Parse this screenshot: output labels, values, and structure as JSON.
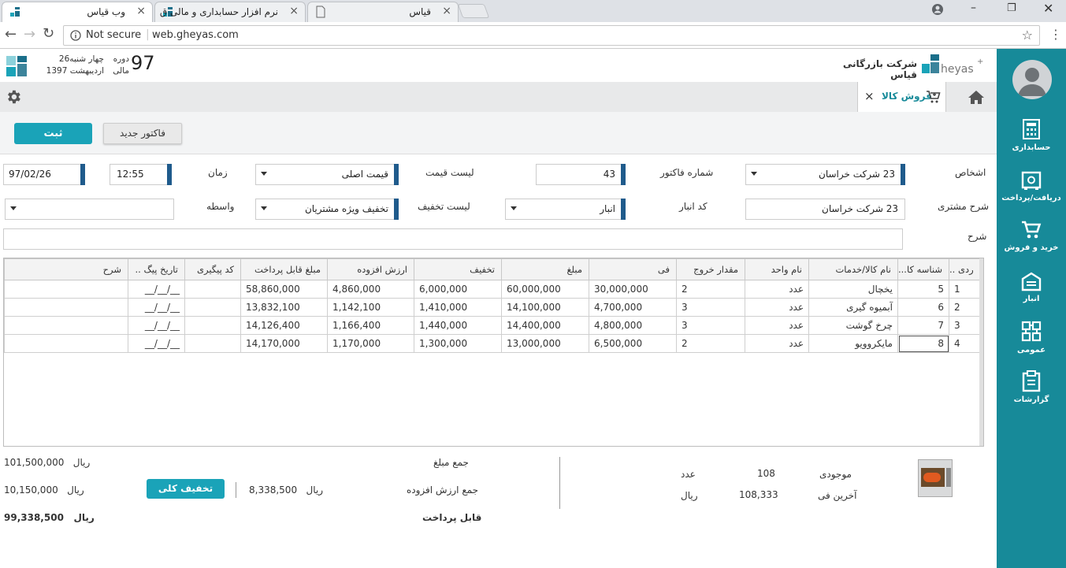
{
  "browser": {
    "tabs": [
      {
        "title": "وب قیاس"
      },
      {
        "title": "نرم افزار حسابداری و مالی ق"
      },
      {
        "title": "قیاس"
      }
    ],
    "security": "Not secure",
    "url": "web.gheyas.com"
  },
  "header": {
    "company_name": "شرکت بازرگانی قیاس",
    "period_number": "97",
    "period_label": "دوره",
    "period_label2": "مالی",
    "weekday": "چهار شنبه26",
    "date_text": "اردیبهشت 1397"
  },
  "tabs": [
    {
      "label": "فروش کالا"
    }
  ],
  "actions": {
    "submit": "ثبت",
    "new_invoice": "فاکتور جدید"
  },
  "form": {
    "persons_label": "اشخاص",
    "persons_value": "23 شرکت خراسان",
    "invoice_no_label": "شماره فاکتور",
    "invoice_no_value": "43",
    "price_list_label": "لیست قیمت",
    "price_list_value": "قیمت اصلی",
    "time_label": "زمان",
    "time_value": "12:55",
    "date_value": "97/02/26",
    "customer_desc_label": "شرح مشتری",
    "customer_desc_value": "23 شرکت خراسان",
    "warehouse_label": "کد انبار",
    "warehouse_value": "انبار",
    "discount_list_label": "لیست تخفیف",
    "discount_list_value": "تخفیف ویژه مشتریان",
    "broker_label": "واسطه",
    "broker_value": "",
    "description_label": "شرح",
    "description_value": ""
  },
  "table": {
    "headers": [
      "ردی ..",
      "شناسه کا...",
      "نام کالا/خدمات",
      "نام واحد",
      "مقدار خروج",
      "فی",
      "مبلغ",
      "تخفیف",
      "ارزش افزوده",
      "مبلغ قابل پرداخت",
      "کد پیگیری",
      "تاریخ پیگ ..",
      "شرح"
    ],
    "rows": [
      [
        "1",
        "5",
        "یخچال",
        "عدد",
        "2",
        "30,000,000",
        "60,000,000",
        "6,000,000",
        "4,860,000",
        "58,860,000",
        "",
        "__/__/__",
        ""
      ],
      [
        "2",
        "6",
        "آبمیوه گیری",
        "عدد",
        "3",
        "4,700,000",
        "14,100,000",
        "1,410,000",
        "1,142,100",
        "13,832,100",
        "",
        "__/__/__",
        ""
      ],
      [
        "3",
        "7",
        "چرخ گوشت",
        "عدد",
        "3",
        "4,800,000",
        "14,400,000",
        "1,440,000",
        "1,166,400",
        "14,126,400",
        "",
        "__/__/__",
        ""
      ],
      [
        "4",
        "8",
        "مایکروویو",
        "عدد",
        "2",
        "6,500,000",
        "13,000,000",
        "1,300,000",
        "1,170,000",
        "14,170,000",
        "",
        "__/__/__",
        ""
      ]
    ]
  },
  "item_info": {
    "stock_label": "موجودی",
    "stock_value": "108",
    "stock_unit": "عدد",
    "last_price_label": "آخرین فی",
    "last_price_value": "108,333",
    "last_price_unit": "ریال"
  },
  "totals": {
    "sum_label": "جمع مبلغ",
    "sum_value": "101,500,000",
    "vat_label": "جمع ارزش افزوده",
    "vat_value": "8,338,500",
    "discount_value": "10,150,000",
    "payable_label": "قابل پرداخت",
    "payable_value": "99,338,500",
    "currency": "ریال",
    "overall_discount_button": "تخفیف کلی"
  },
  "sidebar": {
    "items": [
      {
        "label": "حسابداری",
        "icon": "calculator-icon"
      },
      {
        "label": "دریافت/پرداخت",
        "icon": "safe-icon"
      },
      {
        "label": "خرید و فروش",
        "icon": "cart-icon"
      },
      {
        "label": "انبار",
        "icon": "warehouse-icon"
      },
      {
        "label": "عمومی",
        "icon": "grid-icon"
      },
      {
        "label": "گزارشات",
        "icon": "clipboard-icon"
      }
    ]
  },
  "colors": {
    "accent": "#1aa3b8",
    "sidebar": "#178a99",
    "field_marker": "#1f5b8c"
  }
}
